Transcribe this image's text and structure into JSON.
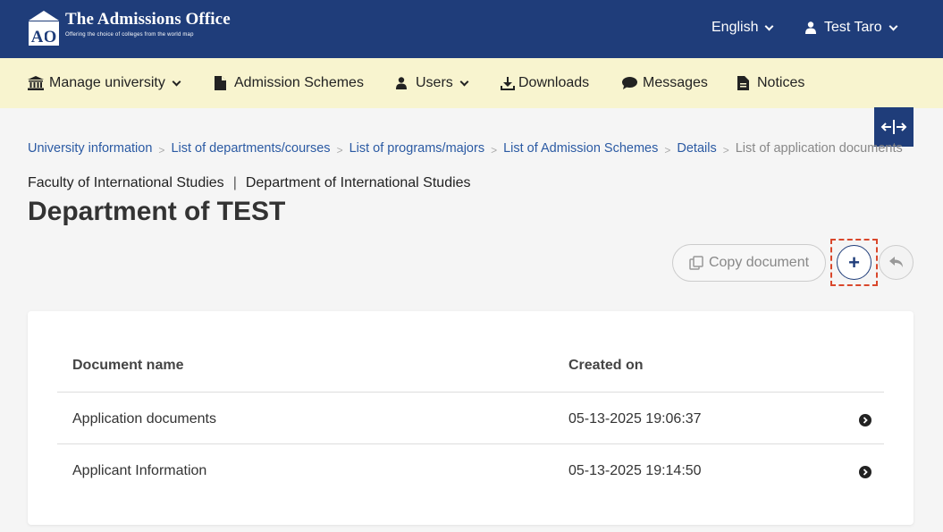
{
  "header": {
    "logo_title": "The Admissions Office",
    "logo_subtitle": "Offering the choice of colleges from the world map",
    "logo_mark": "AO",
    "language": "English",
    "user_name": "Test Taro"
  },
  "nav": {
    "items": [
      {
        "label": "Manage university",
        "icon": "university-icon",
        "dropdown": true
      },
      {
        "label": "Admission Schemes",
        "icon": "document-icon",
        "dropdown": false
      },
      {
        "label": "Users",
        "icon": "user-icon",
        "dropdown": true
      },
      {
        "label": "Downloads",
        "icon": "download-icon",
        "dropdown": false
      },
      {
        "label": "Messages",
        "icon": "message-icon",
        "dropdown": false
      },
      {
        "label": "Notices",
        "icon": "notice-icon",
        "dropdown": false
      }
    ]
  },
  "breadcrumb": {
    "items": [
      "University information",
      "List of departments/courses",
      "List of programs/majors",
      "List of Admission Schemes",
      "Details"
    ],
    "current": "List of application documents"
  },
  "page": {
    "faculty": "Faculty of International Studies",
    "department": "Department of International Studies",
    "title": "Department of TEST"
  },
  "actions": {
    "copy_label": "Copy document",
    "add_label": "+"
  },
  "table": {
    "headers": [
      "Document name",
      "Created on"
    ],
    "rows": [
      {
        "name": "Application documents",
        "created": "05-13-2025 19:06:37"
      },
      {
        "name": "Applicant Information",
        "created": "05-13-2025 19:14:50"
      }
    ]
  },
  "colors": {
    "header_bg": "#1f3d7a",
    "nav_bg": "#f8f4cf",
    "link": "#2b5aa3",
    "focus": "#d9472b"
  }
}
